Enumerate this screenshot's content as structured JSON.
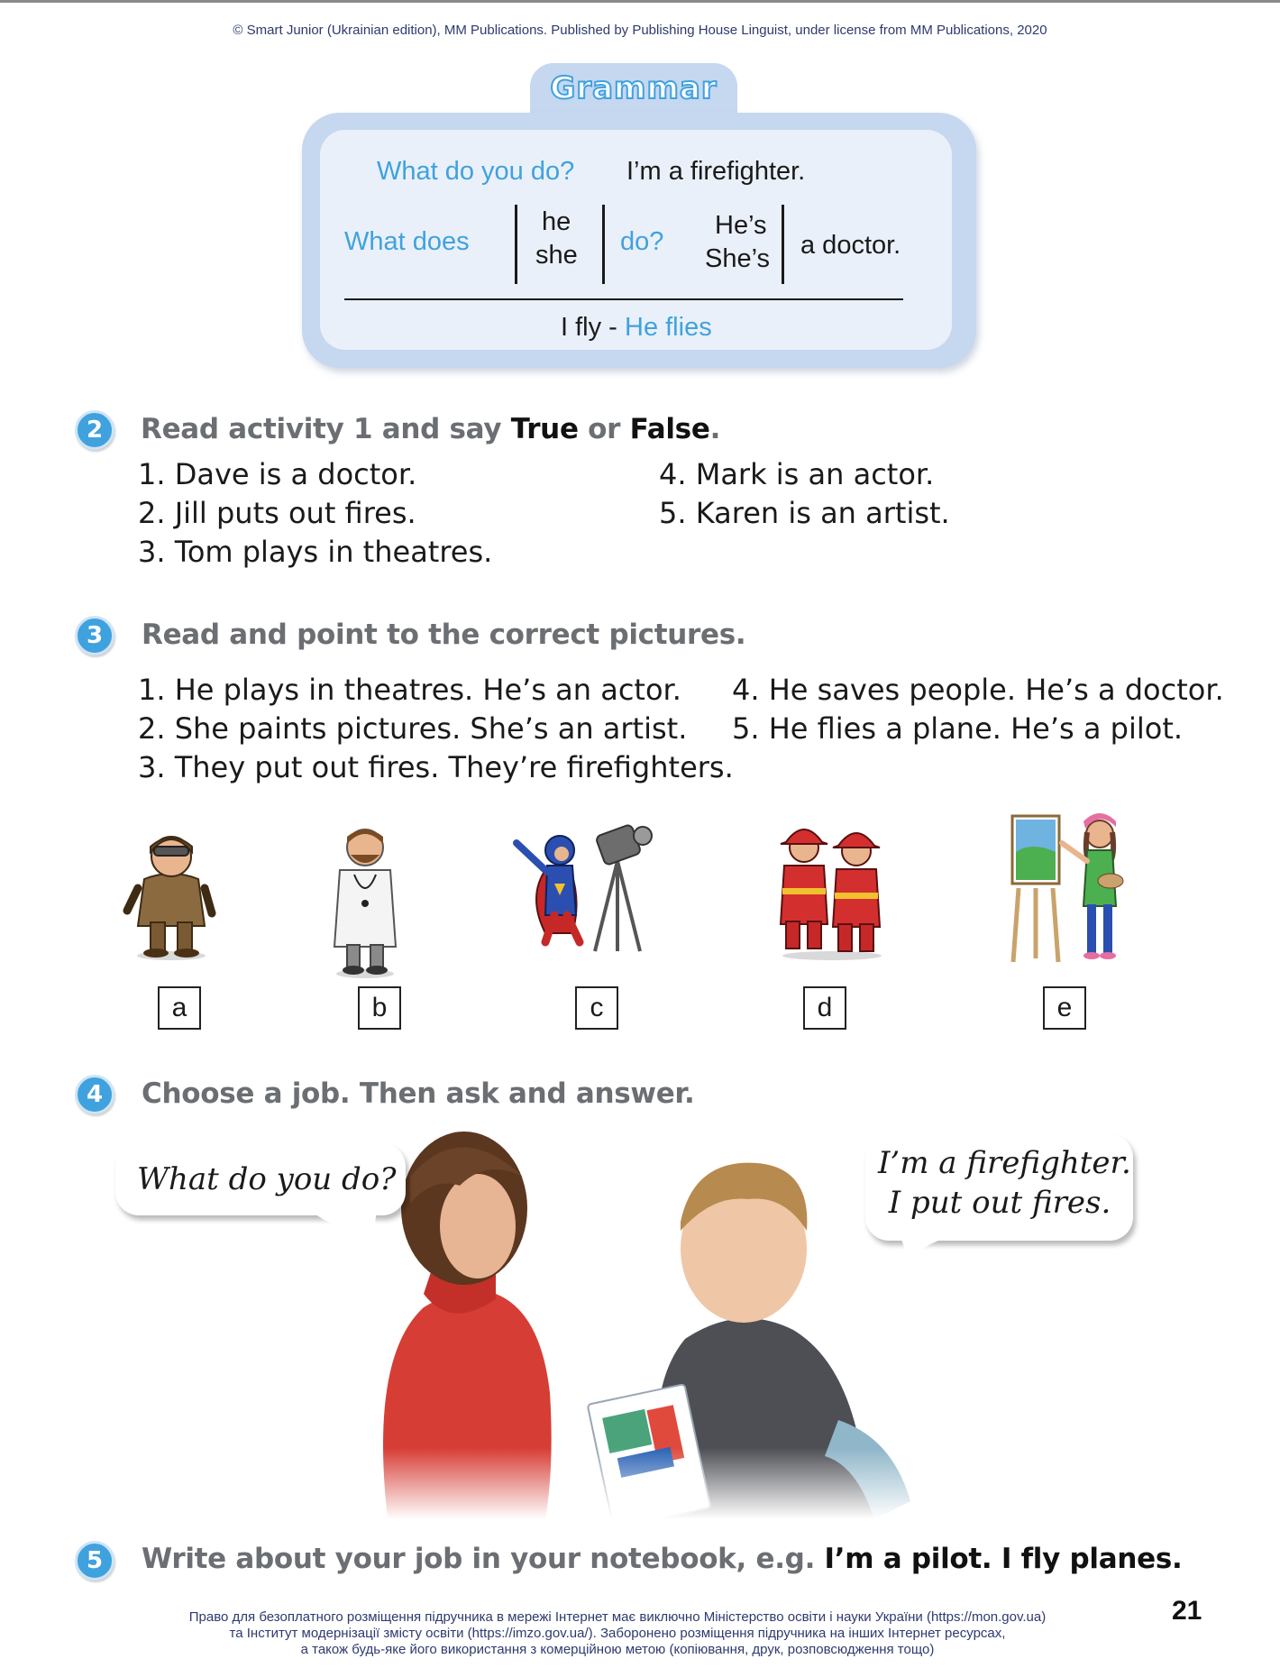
{
  "header": {
    "copyright": "© Smart Junior (Ukrainian edition), MM Publications. Published by Publishing House Linguist, under license from MM Publications, 2020"
  },
  "grammar": {
    "title": "Grammar",
    "q1": "What do you do?",
    "a1": "I’m a firefighter.",
    "q2": "What does",
    "pron_he": "he",
    "pron_she": "she",
    "do": "do?",
    "hes": "He’s",
    "shes": "She’s",
    "a_doctor": "a doctor.",
    "fly": "I fly -",
    "flies": "He flies"
  },
  "activity2": {
    "number": "2",
    "instr_pre": "Read activity 1 and say ",
    "true": "True",
    "or": " or ",
    "false": "False",
    "dot": ".",
    "items": [
      "1. Dave is a doctor.",
      "2. Jill puts out fires.",
      "3. Tom plays in theatres.",
      "4. Mark is an actor.",
      "5. Karen is an artist."
    ]
  },
  "activity3": {
    "number": "3",
    "instruction": "Read and point to the correct pictures.",
    "items": [
      "1. He plays in theatres. He’s an actor.",
      "2. She paints pictures. She’s an artist.",
      "3. They put out fires. They’re firefighters.",
      "4. He saves people. He’s a doctor.",
      "5. He flies a plane. He’s a pilot."
    ],
    "labels": [
      "a",
      "b",
      "c",
      "d",
      "e"
    ]
  },
  "activity4": {
    "number": "4",
    "instruction": "Choose a job. Then ask and answer.",
    "bubble_left": "What do you do?",
    "bubble_right_1": "I’m a firefighter.",
    "bubble_right_2": "I put out fires."
  },
  "activity5": {
    "number": "5",
    "instr_pre": "Write about your job in your notebook, e.g. ",
    "example": "I’m a pilot. I fly planes."
  },
  "footer": {
    "line1": "Право для безоплатного розміщення підручника в мережі Інтернет має виключно Міністерство освіти і науки України (https://mon.gov.ua)",
    "line2": "та Інститут модернізації змісту освіти (https://imzo.gov.ua/). Заборонено розміщення підручника на інших Інтернет ресурсах,",
    "line3": "а також будь-яке його використання з комерційною метою (копіювання, друк, розповсюдження тощо)",
    "page": "21"
  },
  "colors": {
    "accent_blue": "#3fa2de",
    "grammar_frame": "#c6d7f0",
    "grammar_fill": "#eaf0f9",
    "instruction_gray": "#6b6e72"
  }
}
